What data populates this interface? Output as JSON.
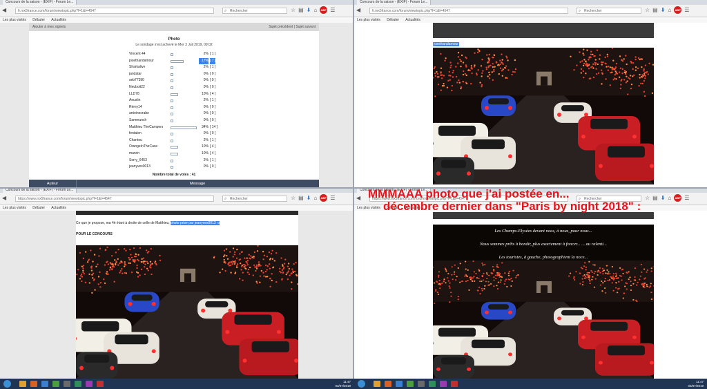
{
  "browser": {
    "tab_title": "Concours de la saison - (EXIF) - Forum Le...",
    "url_short": "fr.mx5france.com/forum/viewtopic.php?f=1&t=4547",
    "url_full": "https://www.mx5france.com/forum/viewtopic.php?f=1&t=4547",
    "search_placeholder": "Rechercher",
    "bookmarks": [
      "Les plus visités",
      "Débuter",
      "Actualités"
    ],
    "abp_label": "ABP"
  },
  "tl": {
    "nav_left": "Ajouter à mes signets",
    "nav_right": "Sujet précédent | Sujet suivant",
    "poll_title": "Photo",
    "poll_subtitle": "Le sondage s'est achevé le Mer 3 Juil 2019, 09:02",
    "rows": [
      {
        "name": "Vincent 44",
        "pct": "2%",
        "count": "[ 1 ]",
        "value": 2
      },
      {
        "name": "josethandamour",
        "pct": "17%",
        "count": "[ 7 ]",
        "value": 17,
        "highlight": true
      },
      {
        "name": "Sharkalive",
        "pct": "2%",
        "count": "[ 1 ]",
        "value": 2
      },
      {
        "name": "jandatar",
        "pct": "0%",
        "count": "[ 0 ]",
        "value": 0
      },
      {
        "name": "seb77390",
        "pct": "0%",
        "count": "[ 0 ]",
        "value": 0
      },
      {
        "name": "Neuboit22",
        "pct": "0%",
        "count": "[ 0 ]",
        "value": 0
      },
      {
        "name": "LLD78",
        "pct": "10%",
        "count": "[ 4 ]",
        "value": 10
      },
      {
        "name": "Aeuslin",
        "pct": "2%",
        "count": "[ 1 ]",
        "value": 2
      },
      {
        "name": "Rémy14",
        "pct": "0%",
        "count": "[ 0 ]",
        "value": 0
      },
      {
        "name": "antoinecrabe",
        "pct": "0%",
        "count": "[ 0 ]",
        "value": 0
      },
      {
        "name": "Sammunch",
        "pct": "0%",
        "count": "[ 0 ]",
        "value": 0
      },
      {
        "name": "Matthieu TheCampers",
        "pct": "34%",
        "count": "[ 14 ]",
        "value": 34
      },
      {
        "name": "fentalen",
        "pct": "0%",
        "count": "[ 0 ]",
        "value": 0
      },
      {
        "name": "Chantou",
        "pct": "2%",
        "count": "[ 1 ]",
        "value": 2
      },
      {
        "name": "OrangeInTheCase",
        "pct": "10%",
        "count": "[ 4 ]",
        "value": 10
      },
      {
        "name": "marvin",
        "pct": "10%",
        "count": "[ 4 ]",
        "value": 10
      },
      {
        "name": "Sorry_6453",
        "pct": "2%",
        "count": "[ 1 ]",
        "value": 2
      },
      {
        "name": "jeanyves0013",
        "pct": "0%",
        "count": "[ 0 ]",
        "value": 0
      }
    ],
    "total": "Nombre total de votes : 41",
    "footer_author": "Auteur",
    "footer_message": "Message"
  },
  "tr": {
    "username": "josethandamour"
  },
  "bl": {
    "text_before": "Ce que je propose, ma 4è étant à droite de celle de Matthieu,",
    "text_selected": "photo prise par jeanyves0013 :o",
    "concours": "POUR LE CONCOURS"
  },
  "br": {
    "headline_line1": "MMMAAA photo que j'ai postée en...",
    "headline_line2": "décembre dernier dans \"Paris by night 2018\"  :",
    "caption1": "Les Champs-Elysées devant nous, à nous, pour nous...",
    "caption2": "Nous sommes prêts à bondir, plus exactement à foncer... ... au ralenti...",
    "caption3": "Les touristes, à gauche, photographient la noce..."
  },
  "taskbar": {
    "time": "11:47",
    "date": "03/07/2019"
  },
  "colors": {
    "highlight": "#3d84e8",
    "headline": "#e8141c",
    "forum_footer": "#3d4b63"
  }
}
